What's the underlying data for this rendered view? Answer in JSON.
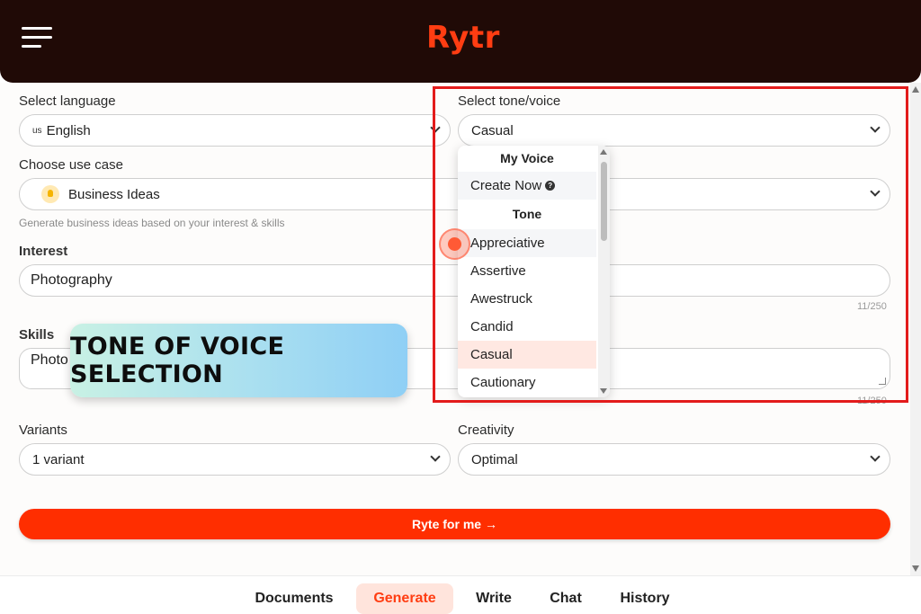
{
  "app": {
    "logo": "Rytr"
  },
  "form": {
    "language": {
      "label": "Select language",
      "flag": "us",
      "value": "English"
    },
    "tone": {
      "label": "Select tone/voice",
      "value": "Casual"
    },
    "use_case": {
      "label": "Choose use case",
      "value": "Business Ideas",
      "helper": "Generate business ideas based on your interest & skills"
    },
    "interest": {
      "label": "Interest",
      "value": "Photography",
      "counter": "11/250"
    },
    "skills": {
      "label": "Skills",
      "value": "Photo",
      "counter": "11/250"
    },
    "variants": {
      "label": "Variants",
      "value": "1 variant"
    },
    "creativity": {
      "label": "Creativity",
      "value": "Optimal"
    },
    "generate_button": "Ryte for me →"
  },
  "tone_dropdown": {
    "header_my_voice": "My Voice",
    "create_now": "Create Now",
    "header_tone": "Tone",
    "items": [
      "Appreciative",
      "Assertive",
      "Awestruck",
      "Candid",
      "Casual",
      "Cautionary"
    ],
    "selected": "Casual"
  },
  "overlay": {
    "banner_text": "TONE OF VOICE SELECTION"
  },
  "bottom_nav": {
    "items": [
      "Documents",
      "Generate",
      "Write",
      "Chat",
      "History"
    ],
    "active": "Generate"
  },
  "colors": {
    "brand": "#ff3d12",
    "header_bg": "#200a06",
    "highlight": "#e31b1b"
  }
}
